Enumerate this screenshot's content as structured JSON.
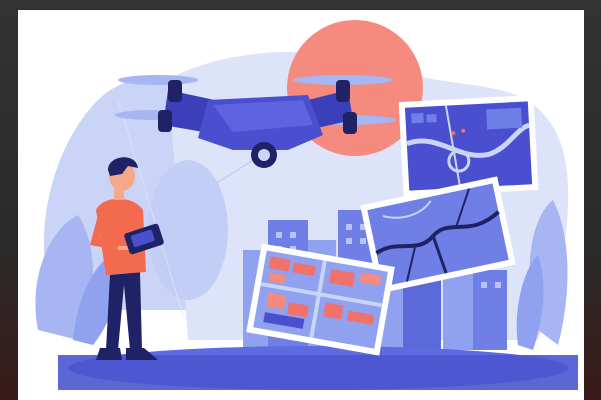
{
  "scene": {
    "subject": "drone-mapping-illustration",
    "colors": {
      "page_background": "#2b2b2b",
      "panel": "#ffffff",
      "soft_blue": "#c9d4f7",
      "mid_blue": "#8fa1ef",
      "deep_blue": "#4a4fd0",
      "navy": "#1f2366",
      "coral": "#f0726a",
      "orange_shirt": "#f26b4f",
      "skin": "#f4a98a"
    },
    "icons": [
      "drone-icon",
      "person-icon",
      "remote-controller-icon",
      "map-card-icon",
      "city-skyline-icon",
      "sun-icon",
      "plant-icon"
    ]
  }
}
